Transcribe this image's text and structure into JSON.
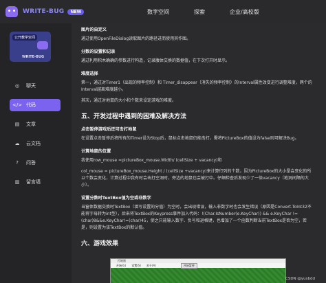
{
  "header": {
    "logo_text": "WRITE-BUG",
    "new_badge": "NEW",
    "nav": [
      "数字空间",
      "探索",
      "企业/高校版"
    ]
  },
  "sidebar": {
    "card": {
      "tag": "公开教学空间",
      "name": "WRITE-BUG"
    },
    "items": [
      {
        "label": "聊天",
        "icon": "chat-icon",
        "glyph": "◎",
        "active": false
      },
      {
        "label": "代码",
        "icon": "code-icon",
        "glyph": "</>",
        "active": true
      },
      {
        "label": "文章",
        "icon": "article-icon",
        "glyph": "▤",
        "active": false
      },
      {
        "label": "云文档",
        "icon": "cloud-doc-icon",
        "glyph": "☁",
        "active": false
      },
      {
        "label": "问答",
        "icon": "qa-icon",
        "glyph": "?",
        "active": false
      },
      {
        "label": "留言墙",
        "icon": "message-wall-icon",
        "glyph": "▥",
        "active": false
      }
    ]
  },
  "article": {
    "h_pic": "图片的自定义",
    "p_pic": "通过使用OpenFileDialog读取图片的路径进而使用其作图。",
    "h_score": "分数的设置和记录",
    "p_score": "通过利用积木确确的参数进行构造，记录腹体交换的数据值，在下次打开时显示。",
    "h_diff": "难度选择",
    "p_diff1": "第一，通过对Timer1（出现的频率控制）和 Timer_disappear（消失的频率控制）的Interval属性改变进行调整难度，两个的Interval越离难度越小。",
    "p_diff2": "其次，通过对地鼠的大小和个数来设定游戏的难度。",
    "h5": "五、开发过程中遇到的困难及解决方法",
    "h_pause": "点击暂停游戏后还可击打地鼠",
    "p_pause": "在设置点击暂停后将所有的Timer设为Stop后，鼠标点击地鼠仍能击打，需将PictureBox的值设为false则可解决Bug。",
    "h_pos": "计算地鼠的位置",
    "p_pos1": "我使用row_mouse =pictureBox_mouse.Width/ (cellSize + vacancy)和",
    "p_pos2": "col_mouse = pictureBox_mouse.Height / (cellSize +vacancy)来计算行列的个数，因为PictureBox的大小是会变化的所以个数会变化，计算过程中我有时会击打空洞时，旁边的地鼠也会被打中。仔细检查后发现少了一倍vacancy（地洞间隔的大小）。",
    "h_textbox": "设置分数时TextBox值为空或非数字",
    "p_textbox": "当窗体数据交换时TextBox（填写设置的分值）为空时，会出现错误，输入非数字时也会发生错误（原因是Convert.ToInt32不能将字母转为int型），后来将TextBox的Keypress事件加入代码：!(Char.IsNumber(e.KeyChar)) && e.KeyChar != (char)8&&e.KeyChar!=(char)45，使之只能输入数字、负号和退格键，也增加了一个函数判断当前TextBox是否为空，若是，则设置为该TextBox的默认值。",
    "h6": "六、游戏效果"
  },
  "screenshot": {
    "title": "打地鼠",
    "menu": [
      "开始(G)",
      "设置(S)",
      "关于(A)"
    ],
    "button": "开始暂停"
  },
  "watermark": "CSDN @yusbdd"
}
